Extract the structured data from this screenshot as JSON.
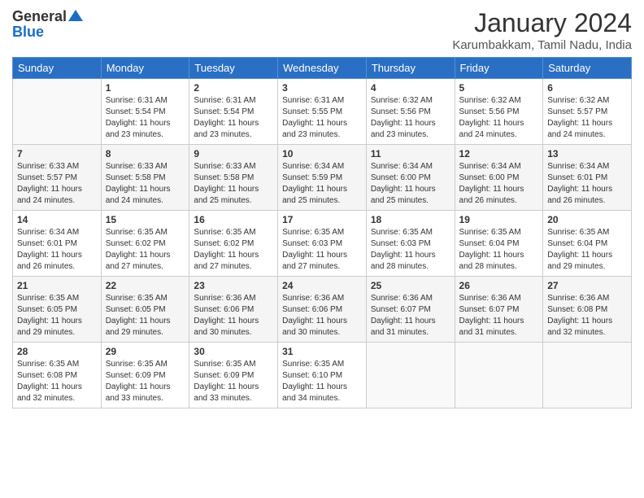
{
  "header": {
    "logo": {
      "general": "General",
      "blue": "Blue"
    },
    "title": "January 2024",
    "subtitle": "Karumbakkam, Tamil Nadu, India"
  },
  "calendar": {
    "headers": [
      "Sunday",
      "Monday",
      "Tuesday",
      "Wednesday",
      "Thursday",
      "Friday",
      "Saturday"
    ],
    "weeks": [
      [
        {
          "day": "",
          "info": ""
        },
        {
          "day": "1",
          "info": "Sunrise: 6:31 AM\nSunset: 5:54 PM\nDaylight: 11 hours\nand 23 minutes."
        },
        {
          "day": "2",
          "info": "Sunrise: 6:31 AM\nSunset: 5:54 PM\nDaylight: 11 hours\nand 23 minutes."
        },
        {
          "day": "3",
          "info": "Sunrise: 6:31 AM\nSunset: 5:55 PM\nDaylight: 11 hours\nand 23 minutes."
        },
        {
          "day": "4",
          "info": "Sunrise: 6:32 AM\nSunset: 5:56 PM\nDaylight: 11 hours\nand 23 minutes."
        },
        {
          "day": "5",
          "info": "Sunrise: 6:32 AM\nSunset: 5:56 PM\nDaylight: 11 hours\nand 24 minutes."
        },
        {
          "day": "6",
          "info": "Sunrise: 6:32 AM\nSunset: 5:57 PM\nDaylight: 11 hours\nand 24 minutes."
        }
      ],
      [
        {
          "day": "7",
          "info": "Sunrise: 6:33 AM\nSunset: 5:57 PM\nDaylight: 11 hours\nand 24 minutes."
        },
        {
          "day": "8",
          "info": "Sunrise: 6:33 AM\nSunset: 5:58 PM\nDaylight: 11 hours\nand 24 minutes."
        },
        {
          "day": "9",
          "info": "Sunrise: 6:33 AM\nSunset: 5:58 PM\nDaylight: 11 hours\nand 25 minutes."
        },
        {
          "day": "10",
          "info": "Sunrise: 6:34 AM\nSunset: 5:59 PM\nDaylight: 11 hours\nand 25 minutes."
        },
        {
          "day": "11",
          "info": "Sunrise: 6:34 AM\nSunset: 6:00 PM\nDaylight: 11 hours\nand 25 minutes."
        },
        {
          "day": "12",
          "info": "Sunrise: 6:34 AM\nSunset: 6:00 PM\nDaylight: 11 hours\nand 26 minutes."
        },
        {
          "day": "13",
          "info": "Sunrise: 6:34 AM\nSunset: 6:01 PM\nDaylight: 11 hours\nand 26 minutes."
        }
      ],
      [
        {
          "day": "14",
          "info": "Sunrise: 6:34 AM\nSunset: 6:01 PM\nDaylight: 11 hours\nand 26 minutes."
        },
        {
          "day": "15",
          "info": "Sunrise: 6:35 AM\nSunset: 6:02 PM\nDaylight: 11 hours\nand 27 minutes."
        },
        {
          "day": "16",
          "info": "Sunrise: 6:35 AM\nSunset: 6:02 PM\nDaylight: 11 hours\nand 27 minutes."
        },
        {
          "day": "17",
          "info": "Sunrise: 6:35 AM\nSunset: 6:03 PM\nDaylight: 11 hours\nand 27 minutes."
        },
        {
          "day": "18",
          "info": "Sunrise: 6:35 AM\nSunset: 6:03 PM\nDaylight: 11 hours\nand 28 minutes."
        },
        {
          "day": "19",
          "info": "Sunrise: 6:35 AM\nSunset: 6:04 PM\nDaylight: 11 hours\nand 28 minutes."
        },
        {
          "day": "20",
          "info": "Sunrise: 6:35 AM\nSunset: 6:04 PM\nDaylight: 11 hours\nand 29 minutes."
        }
      ],
      [
        {
          "day": "21",
          "info": "Sunrise: 6:35 AM\nSunset: 6:05 PM\nDaylight: 11 hours\nand 29 minutes."
        },
        {
          "day": "22",
          "info": "Sunrise: 6:35 AM\nSunset: 6:05 PM\nDaylight: 11 hours\nand 29 minutes."
        },
        {
          "day": "23",
          "info": "Sunrise: 6:36 AM\nSunset: 6:06 PM\nDaylight: 11 hours\nand 30 minutes."
        },
        {
          "day": "24",
          "info": "Sunrise: 6:36 AM\nSunset: 6:06 PM\nDaylight: 11 hours\nand 30 minutes."
        },
        {
          "day": "25",
          "info": "Sunrise: 6:36 AM\nSunset: 6:07 PM\nDaylight: 11 hours\nand 31 minutes."
        },
        {
          "day": "26",
          "info": "Sunrise: 6:36 AM\nSunset: 6:07 PM\nDaylight: 11 hours\nand 31 minutes."
        },
        {
          "day": "27",
          "info": "Sunrise: 6:36 AM\nSunset: 6:08 PM\nDaylight: 11 hours\nand 32 minutes."
        }
      ],
      [
        {
          "day": "28",
          "info": "Sunrise: 6:35 AM\nSunset: 6:08 PM\nDaylight: 11 hours\nand 32 minutes."
        },
        {
          "day": "29",
          "info": "Sunrise: 6:35 AM\nSunset: 6:09 PM\nDaylight: 11 hours\nand 33 minutes."
        },
        {
          "day": "30",
          "info": "Sunrise: 6:35 AM\nSunset: 6:09 PM\nDaylight: 11 hours\nand 33 minutes."
        },
        {
          "day": "31",
          "info": "Sunrise: 6:35 AM\nSunset: 6:10 PM\nDaylight: 11 hours\nand 34 minutes."
        },
        {
          "day": "",
          "info": ""
        },
        {
          "day": "",
          "info": ""
        },
        {
          "day": "",
          "info": ""
        }
      ]
    ]
  }
}
